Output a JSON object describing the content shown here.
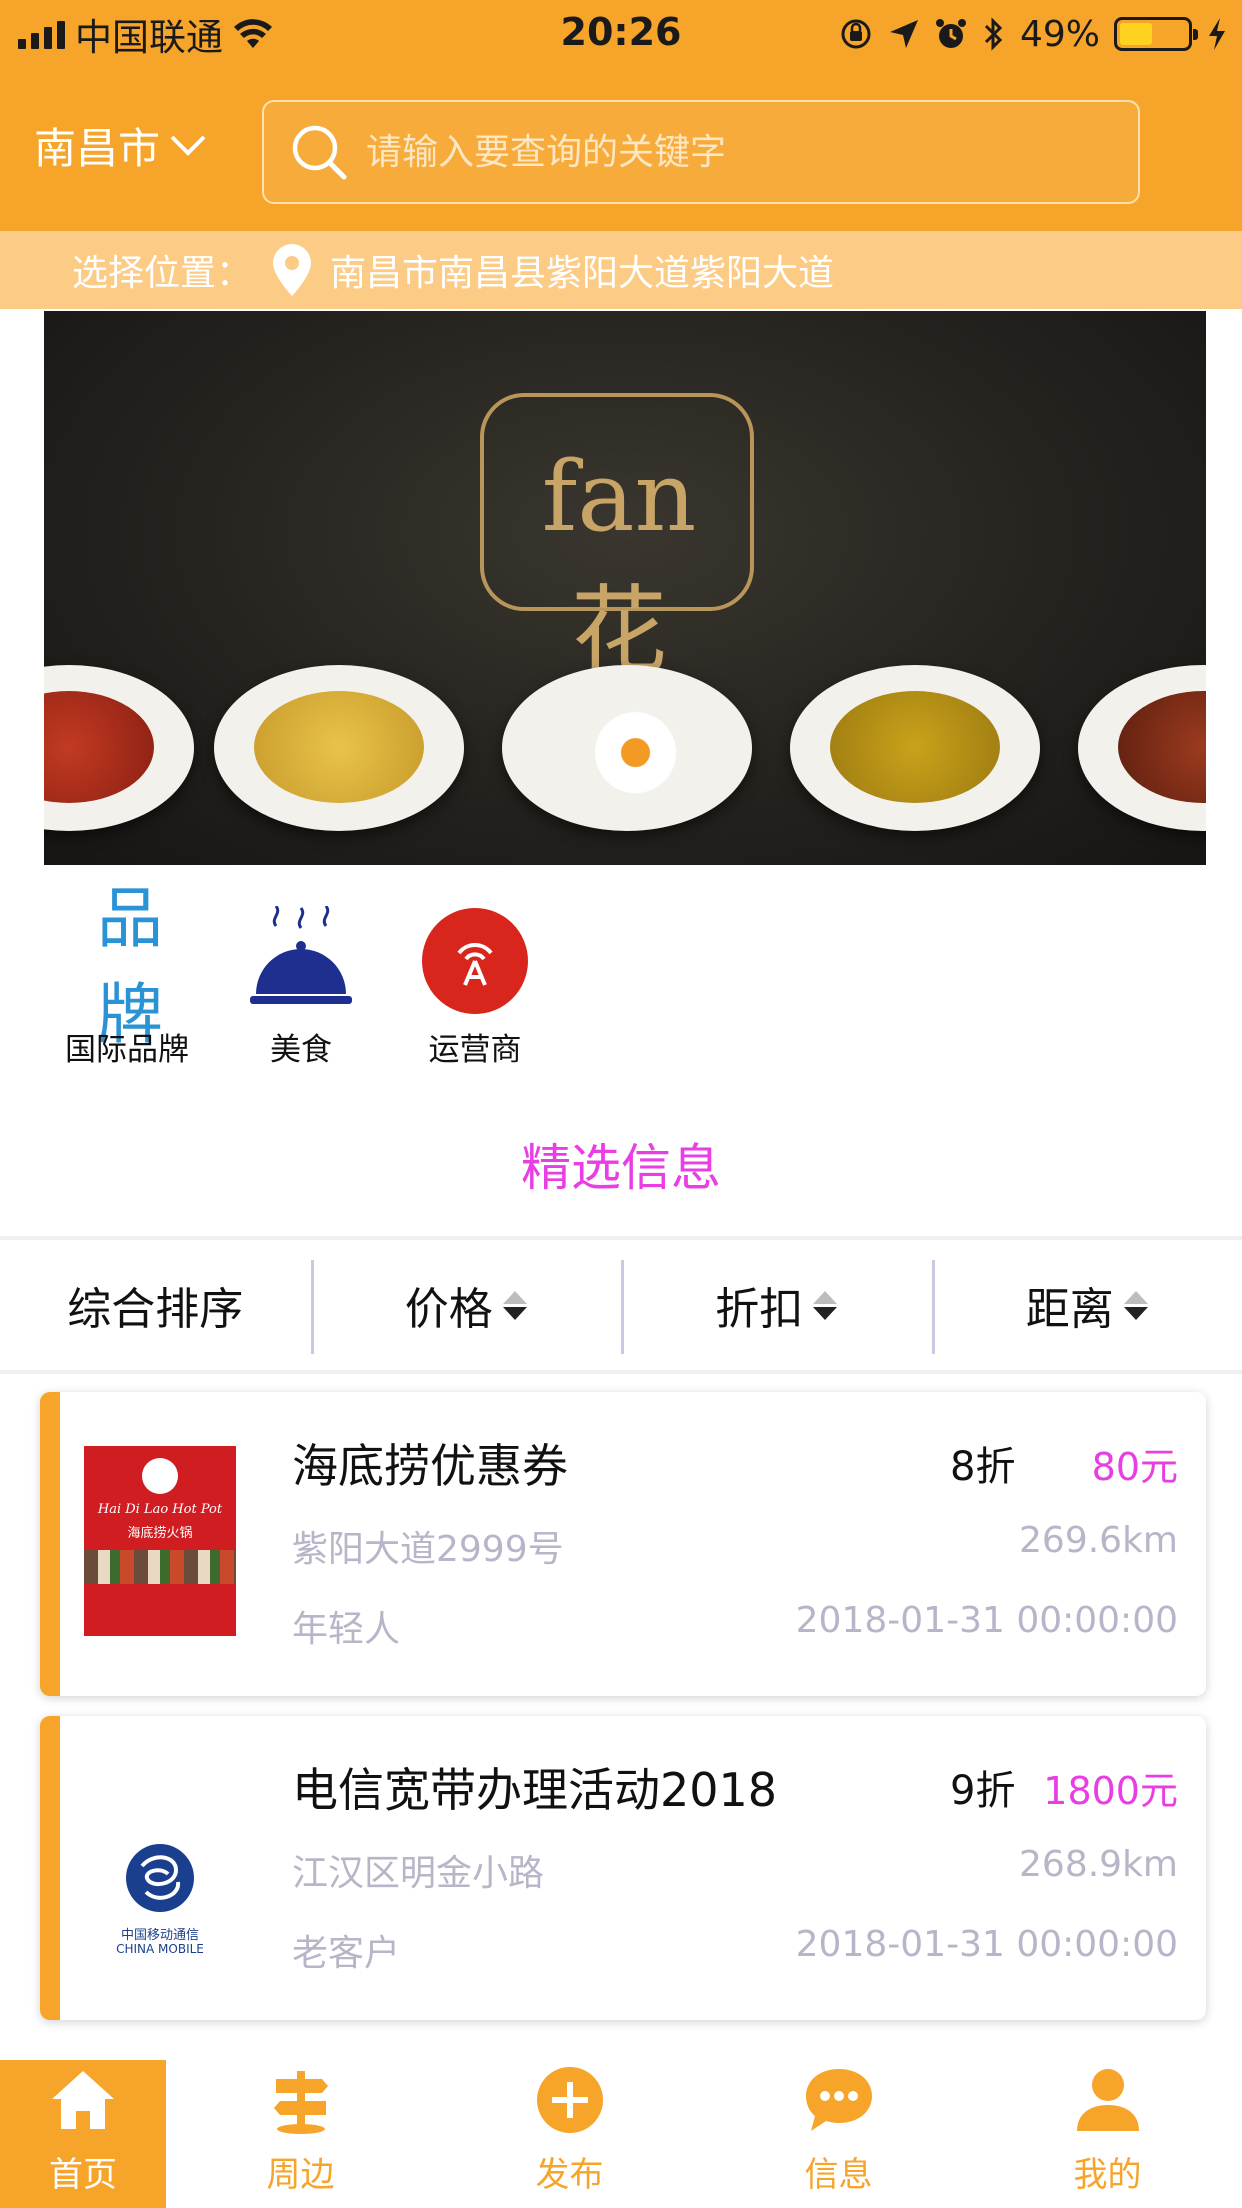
{
  "status_bar": {
    "carrier": "中国联通",
    "time": "20:26",
    "battery_percent": "49%",
    "battery_level": 0.49
  },
  "header": {
    "city": "南昌市",
    "search_placeholder": "请输入要查询的关键字"
  },
  "location": {
    "label": "选择位置：",
    "address": "南昌市南昌县紫阳大道紫阳大道"
  },
  "banner": {
    "logo_text": "fan 花"
  },
  "categories": [
    {
      "label": "国际品牌",
      "icon": "brand-icon"
    },
    {
      "label": "美食",
      "icon": "food-cloche-icon"
    },
    {
      "label": "运营商",
      "icon": "operator-signal-icon"
    }
  ],
  "section_title": "精选信息",
  "sort_bar": [
    {
      "label": "综合排序"
    },
    {
      "label": "价格"
    },
    {
      "label": "折扣"
    },
    {
      "label": "距离"
    }
  ],
  "listings": [
    {
      "title": "海底捞优惠券",
      "discount": "8折",
      "price": "80元",
      "address": "紫阳大道2999号",
      "distance": "269.6km",
      "tag": "年轻人",
      "date": "2018-01-31 00:00:00",
      "thumb_brand": "Hai Di Lao Hot Pot",
      "thumb_brand_cn": "海底捞火锅"
    },
    {
      "title": "电信宽带办理活动2018",
      "discount": "9折",
      "price": "1800元",
      "address": "江汉区明金小路",
      "distance": "268.9km",
      "tag": "老客户",
      "date": "2018-01-31 00:00:00",
      "thumb_brand": "CHINA MOBILE",
      "thumb_brand_cn": "中国移动通信"
    }
  ],
  "tab_bar": [
    {
      "label": "首页",
      "icon": "home-icon",
      "active": true
    },
    {
      "label": "周边",
      "icon": "signpost-icon",
      "active": false
    },
    {
      "label": "发布",
      "icon": "plus-circle-icon",
      "active": false
    },
    {
      "label": "信息",
      "icon": "chat-bubble-icon",
      "active": false
    },
    {
      "label": "我的",
      "icon": "user-icon",
      "active": false
    }
  ],
  "colors": {
    "primary": "#f7a42a",
    "location_bar": "#fccb85",
    "highlight": "#e83ee3",
    "muted_text": "#b6b6c8"
  }
}
